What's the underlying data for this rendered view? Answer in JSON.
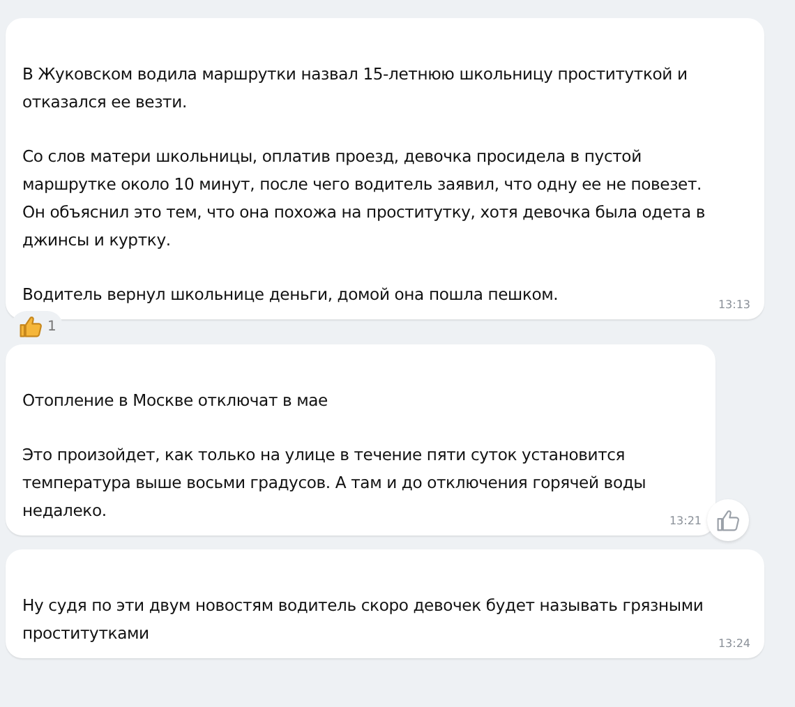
{
  "messages": [
    {
      "paragraphs": [
        "В Жуковском водила маршрутки назвал 15-летнюю школьницу проституткой и\nотказался ее везти.",
        "Со слов матери школьницы, оплатив проезд, девочка просидела в пустой\nмаршрутке около 10 минут, после чего водитель заявил, что одну ее не повезет.\nОн объяснил это тем, что она похожа на проститутку, хотя девочка была одета в\nджинсы и куртку.",
        "Водитель вернул школьнице деньги, домой она пошла пешком."
      ],
      "time": "13:13",
      "reaction_count": "1",
      "like_button": false
    },
    {
      "paragraphs": [
        "Отопление в Москве отключат в мае",
        "Это произойдет, как только на улице в течение пяти суток установится\nтемпература выше восьми градусов. А там и до отключения горячей воды\nнедалеко."
      ],
      "time": "13:21",
      "like_button": true
    },
    {
      "paragraphs": [
        "Ну судя по эти двум новостям водитель скоро девочек будет называть грязными\nпроститутками"
      ],
      "time": "13:24",
      "like_button": false
    }
  ]
}
